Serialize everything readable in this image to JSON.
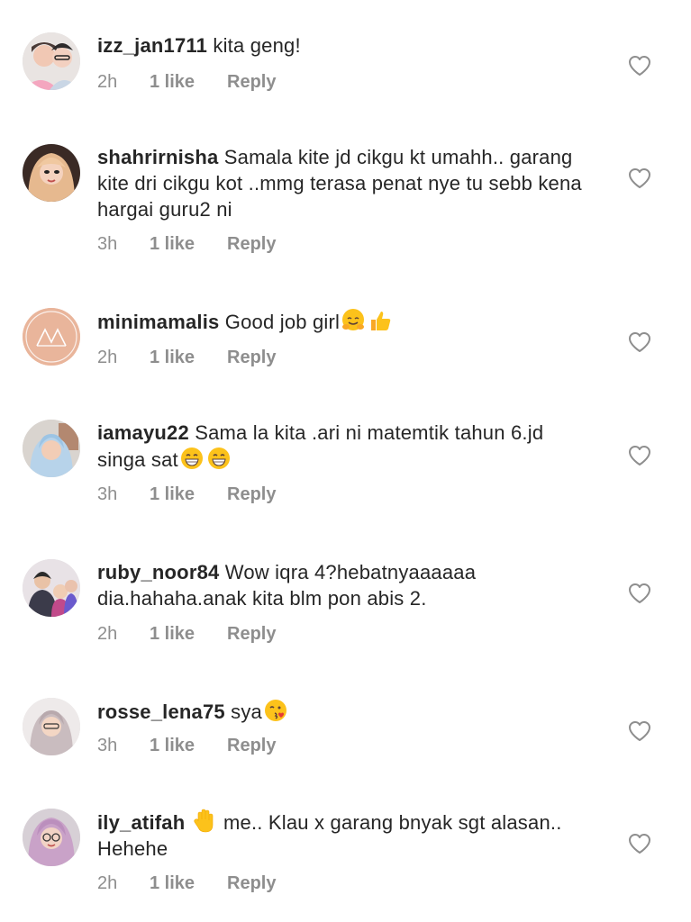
{
  "comments": [
    {
      "username": "izz_jan1711",
      "text": "kita geng!",
      "time": "2h",
      "likes": "1 like",
      "reply": "Reply"
    },
    {
      "username": "shahrirnisha",
      "text": "Samala kite jd cikgu kt umahh.. garang kite dri cikgu kot ..mmg terasa penat nye tu sebb kena hargai guru2 ni",
      "time": "3h",
      "likes": "1 like",
      "reply": "Reply"
    },
    {
      "username": "minimamalis",
      "text": "Good job girl",
      "emojis": [
        "hugging-face",
        "thumbs-up"
      ],
      "time": "2h",
      "likes": "1 like",
      "reply": "Reply"
    },
    {
      "username": "iamayu22",
      "text": "Sama la kita .ari ni matemtik tahun 6.jd singa sat",
      "emojis": [
        "grinning-face",
        "grinning-face"
      ],
      "time": "3h",
      "likes": "1 like",
      "reply": "Reply"
    },
    {
      "username": "ruby_noor84",
      "text": "Wow iqra 4?hebatnyaaaaaa dia.hahaha.anak kita blm pon abis 2.",
      "time": "2h",
      "likes": "1 like",
      "reply": "Reply"
    },
    {
      "username": "rosse_lena75",
      "text": "sya",
      "emojis": [
        "kissing-face"
      ],
      "time": "3h",
      "likes": "1 like",
      "reply": "Reply"
    },
    {
      "username": "ily_atifah",
      "emojis": [
        "raised-hand"
      ],
      "text": "me.. Klau x garang bnyak sgt alasan.. Hehehe",
      "time": "2h",
      "likes": "1 like",
      "reply": "Reply"
    }
  ],
  "colors": {
    "text": "#262626",
    "meta": "#8e8e8e",
    "heart_outline": "#8e8e8e",
    "minimamalis_avatar": "#e9b59b"
  },
  "icons": {
    "like": "heart-outline-icon"
  }
}
